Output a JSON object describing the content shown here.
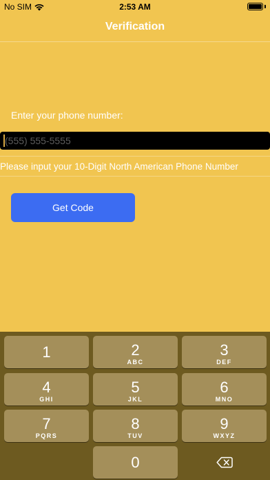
{
  "status_bar": {
    "carrier": "No SIM",
    "time": "2:53 AM"
  },
  "nav": {
    "title": "Verification"
  },
  "form": {
    "phone_label": "Enter your phone number:",
    "phone_placeholder": "(555) 555-5555",
    "phone_value": "",
    "helper_text": "Please input your 10-Digit North American Phone Number",
    "get_code_label": "Get Code"
  },
  "keypad": {
    "keys": [
      {
        "digit": "1",
        "letters": ""
      },
      {
        "digit": "2",
        "letters": "ABC"
      },
      {
        "digit": "3",
        "letters": "DEF"
      },
      {
        "digit": "4",
        "letters": "GHI"
      },
      {
        "digit": "5",
        "letters": "JKL"
      },
      {
        "digit": "6",
        "letters": "MNO"
      },
      {
        "digit": "7",
        "letters": "PQRS"
      },
      {
        "digit": "8",
        "letters": "TUV"
      },
      {
        "digit": "9",
        "letters": "WXYZ"
      },
      {
        "digit": "0",
        "letters": ""
      }
    ],
    "delete_icon": "backspace-icon"
  },
  "colors": {
    "background": "#f1c550",
    "button": "#3c6cf2",
    "keypad_bg": "#6d5a20",
    "key_bg": "#a48f5a"
  }
}
